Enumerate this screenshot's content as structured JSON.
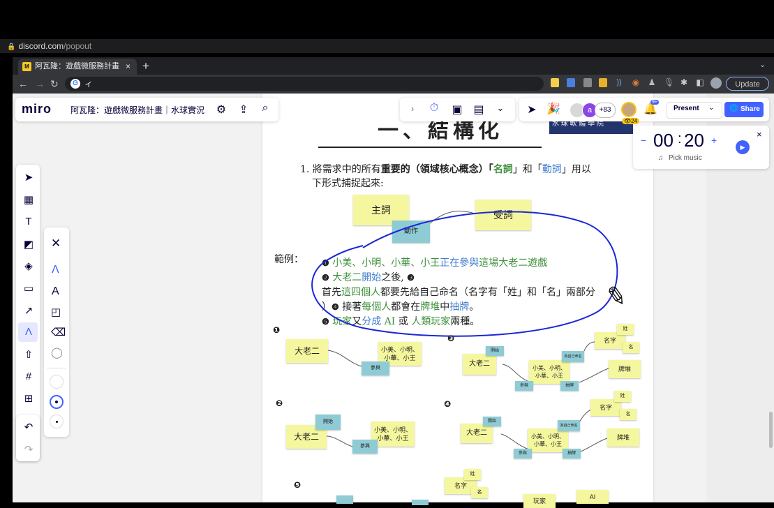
{
  "address_bar": {
    "domain": "discord.com",
    "path": "/popout"
  },
  "browser": {
    "tab_title": "阿瓦隆：遊戲微服務計畫｜水球軟…",
    "tab_favicon": "M",
    "tab_close": "×",
    "new_tab": "+",
    "omnibox_text": "ィ",
    "update_label": "Update"
  },
  "miro": {
    "logo": "miro",
    "board_title": "阿瓦隆：遊戲微服務計畫｜水球實況",
    "collaborators_count": "+83",
    "avatar_letter": "a",
    "viewers_badge": "24",
    "notif_badge": "9+",
    "present_label": "Present",
    "share_label": "Share"
  },
  "timer": {
    "minutes": "00",
    "seconds": "20",
    "pick_music": "Pick music",
    "minus": "−",
    "plus": "+",
    "close": "×"
  },
  "document": {
    "heading": "一、結構化",
    "banner": "水 球 軟 體 學 院",
    "step1_a": "1. 將需求中的所有",
    "step1_b": "重要的（領域核心概念）「",
    "step1_noun": "名詞",
    "step1_c": "」和「",
    "step1_verb": "動詞",
    "step1_d": "」用以",
    "step1_line2": "下形式捕捉起來:",
    "diag_subject": "主詞",
    "diag_object": "受詞",
    "diag_action": "動作",
    "example_label": "範例：",
    "ex1_num": "❶",
    "ex1_a": "小美、小明、小華、小王",
    "ex1_b": "正在參與",
    "ex1_c": "這場大老二遊戲",
    "ex2_num": "❷",
    "ex2_a": "大老二",
    "ex2_b": "開始",
    "ex2_c": "之後,",
    "ex3_num": "❸",
    "ex3_a": "首先",
    "ex3_b": "這四個人",
    "ex3_c": "都要先給自己命名（名字有「姓」和「名」兩部分",
    "ex4_a": "）",
    "ex4_num": "❹",
    "ex4_b": "接著",
    "ex4_c": "每個人",
    "ex4_d": "都會在",
    "ex4_e": "牌堆",
    "ex4_f": "中",
    "ex4_g": "抽牌",
    "ex4_h": "。",
    "ex5_num": "❺",
    "ex5_a": "玩家",
    "ex5_b": "又",
    "ex5_c": "分成",
    "ex5_d": " AI ",
    "ex5_e": "或 ",
    "ex5_f": "人類玩家",
    "ex5_g": "兩種。"
  },
  "diagrams": {
    "d1": {
      "num": "❶",
      "big2": "大老二",
      "players": "小美、小明、\n小華、小王",
      "action": "參與"
    },
    "d2": {
      "num": "❷",
      "big2": "大老二",
      "players": "小美、小明、\n小華、小王",
      "action": "參與",
      "start": "開始"
    },
    "d3": {
      "num": "❸",
      "big2": "大老二",
      "players": "小美、小明、\n小華、小王",
      "start": "開始",
      "join": "參與",
      "name": "名字",
      "surname": "姓",
      "given": "名",
      "deck": "牌堆",
      "draw": "抽牌",
      "naming": "為自己命名"
    },
    "d4": {
      "num": "❹",
      "big2": "大老二",
      "players": "小美、小明、\n小華、小王",
      "start": "開始",
      "join": "參與",
      "name": "名字",
      "surname": "姓",
      "given": "名",
      "deck": "牌堆",
      "draw": "抽牌",
      "naming": "為自己命名"
    },
    "d5": {
      "num": "❺",
      "name": "名字",
      "surname": "姓",
      "given": "名",
      "player": "玩家",
      "ai": "AI"
    }
  },
  "colors": {
    "accent_blue": "#4262ff",
    "sticky_yellow": "#f5f79e",
    "sticky_blue": "#8fcbd4",
    "annotation_blue": "#1a27d6"
  }
}
